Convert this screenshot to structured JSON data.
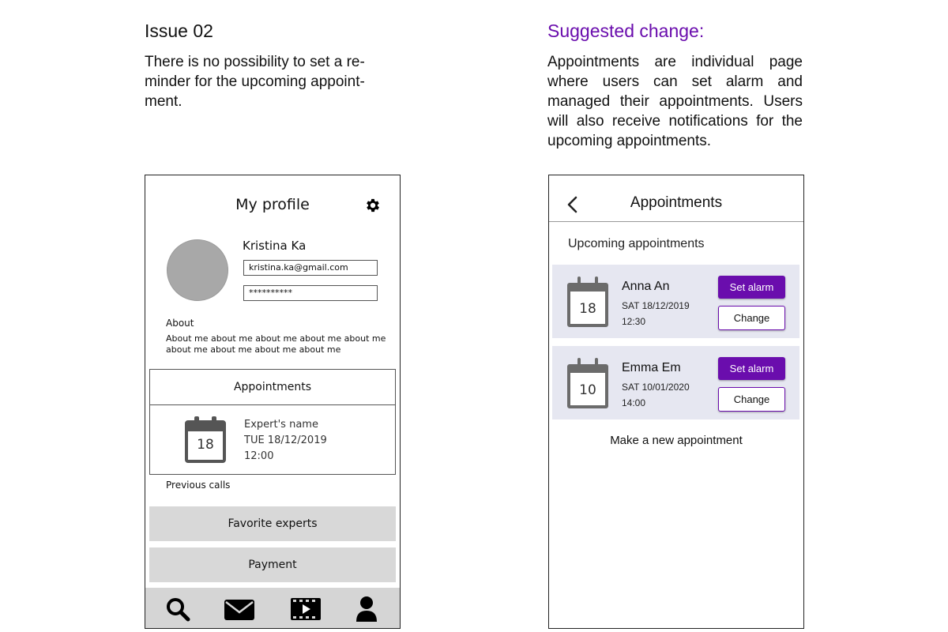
{
  "colors": {
    "accent": "#6a0dad",
    "card_bg": "#e6e7f1",
    "gray_button": "#d8d8d8",
    "avatar": "#a8a8a8"
  },
  "issue": {
    "heading": "Issue 02",
    "text": "There is no possibility to set a reminder for the upcoming appointment."
  },
  "suggestion": {
    "heading": "Suggested change:",
    "text": "Appointments are individual page where users can set alarm and managed their appointments. Users will also receive notifications for the upcoming appointments."
  },
  "profile_screen": {
    "title": "My profile",
    "settings_icon": "gear-icon",
    "name": "Kristina Ka",
    "email": "kristina.ka@gmail.com",
    "password": "**********",
    "about_heading": "About",
    "about_text": "About me about me about me about me about me about me about me about me about me",
    "appointments": {
      "heading": "Appointments",
      "calendar_day": "18",
      "expert_name": "Expert's name",
      "date": "TUE 18/12/2019",
      "time": "12:00"
    },
    "previous_calls": "Previous calls",
    "favorite_experts": "Favorite experts",
    "payment": "Payment",
    "nav": [
      "search-icon",
      "mail-icon",
      "video-icon",
      "profile-icon"
    ]
  },
  "appointments_screen": {
    "title": "Appointments",
    "back_icon": "chevron-left-icon",
    "subtitle": "Upcoming appointments",
    "items": [
      {
        "calendar_day": "18",
        "name": "Anna An",
        "date": "SAT 18/12/2019",
        "time": "12:30",
        "alarm_label": "Set alarm",
        "change_label": "Change"
      },
      {
        "calendar_day": "10",
        "name": "Emma Em",
        "date": "SAT 10/01/2020",
        "time": "14:00",
        "alarm_label": "Set alarm",
        "change_label": "Change"
      }
    ],
    "new_appointment": "Make a new appointment"
  }
}
